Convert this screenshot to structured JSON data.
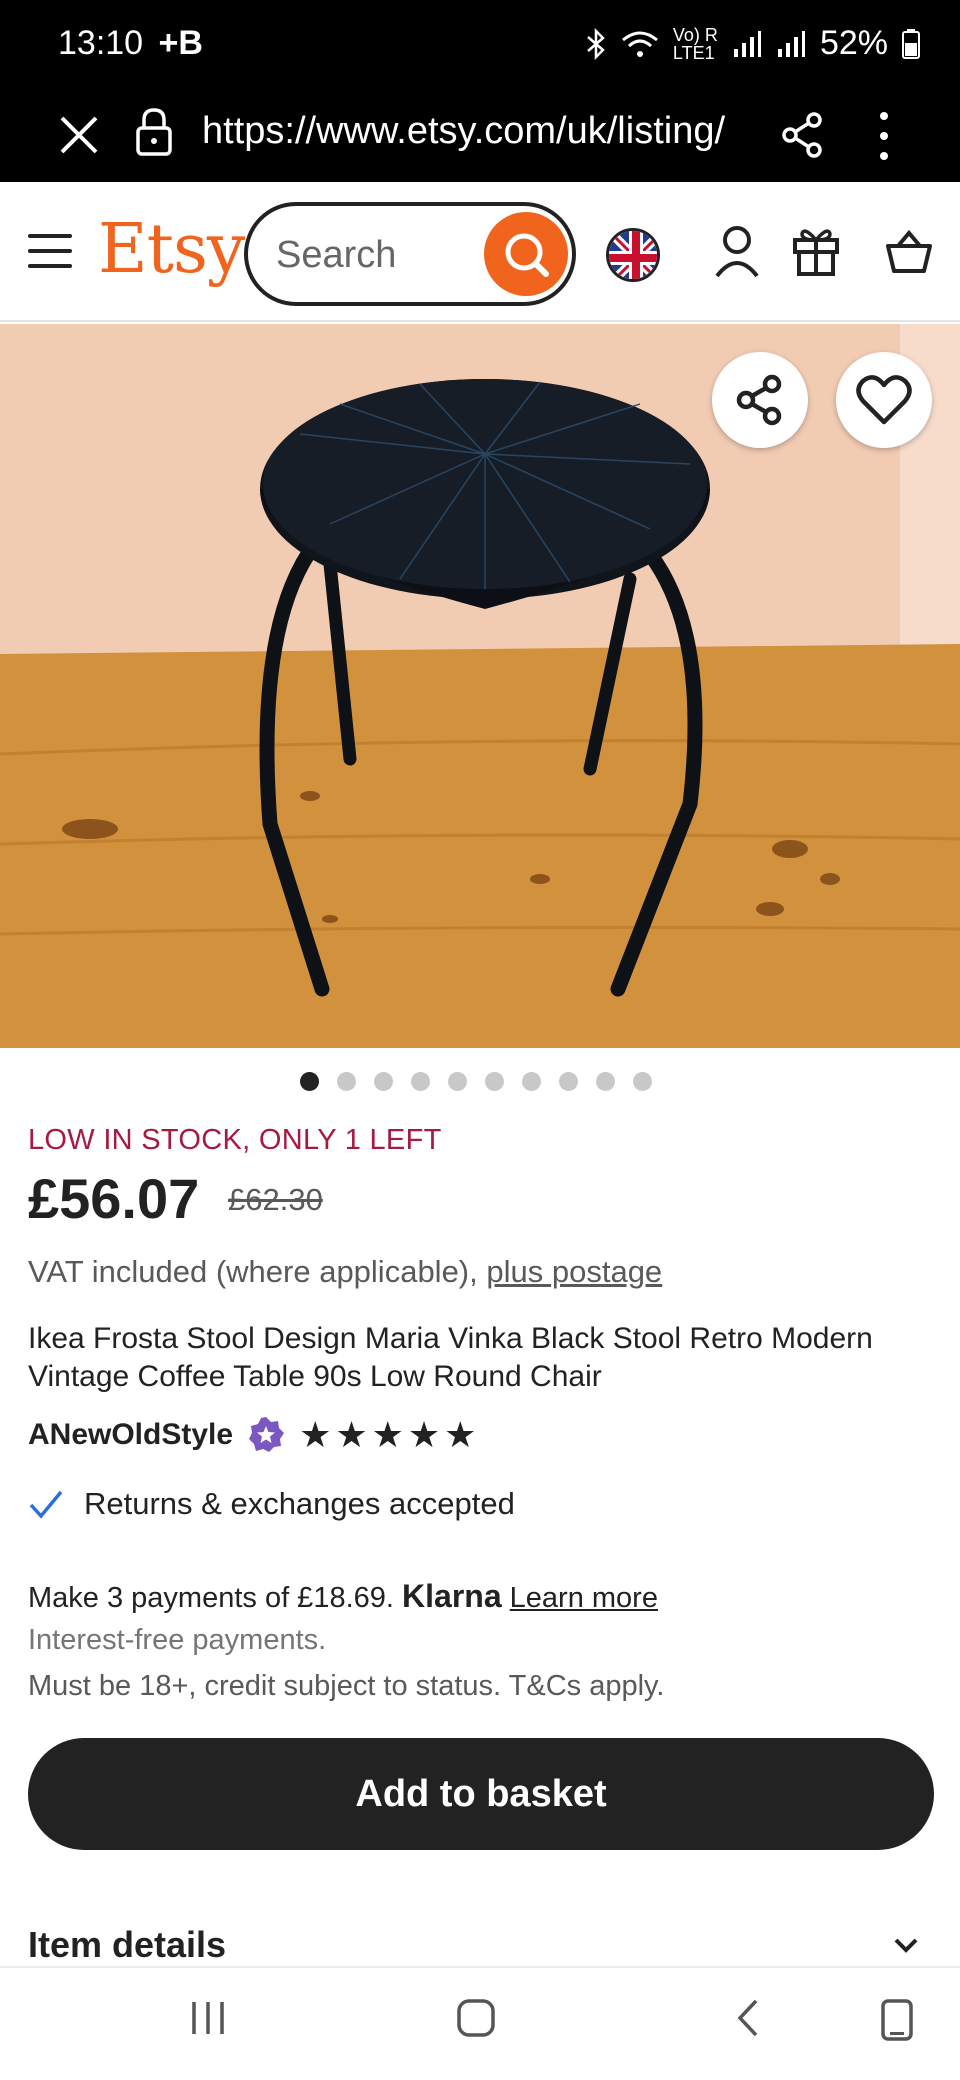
{
  "status_bar": {
    "time": "13:10",
    "carrier_badge": "+B",
    "network_label": "Vo) R\nLTE1",
    "battery": "52%"
  },
  "browser": {
    "url": "https://www.etsy.com/uk/listing/"
  },
  "header": {
    "logo": "Etsy",
    "search_placeholder": "Search",
    "brand_color": "#f1641e"
  },
  "gallery": {
    "image_count": 10,
    "active_index": 0
  },
  "listing": {
    "stock_notice": "LOW IN STOCK, ONLY 1 LEFT",
    "price": "£56.07",
    "original_price": "£62.30",
    "vat_text": "VAT included (where applicable),",
    "postage_link": "plus postage",
    "title": "Ikea Frosta Stool Design Maria Vinka Black Stool Retro Modern Vintage Coffee Table 90s Low Round Chair",
    "shop_name": "ANewOldStyle",
    "rating_stars": "★★★★★",
    "rating": 5,
    "returns": "Returns & exchanges accepted"
  },
  "payments": {
    "installments_text": "Make 3 payments of £18.69.",
    "provider": "Klarna",
    "learn_more": "Learn more",
    "interest_free": "Interest-free payments.",
    "terms": "Must be 18+, credit subject to status. T&Cs apply."
  },
  "actions": {
    "add_to_basket": "Add to basket"
  },
  "sections": {
    "item_details": "Item details"
  }
}
